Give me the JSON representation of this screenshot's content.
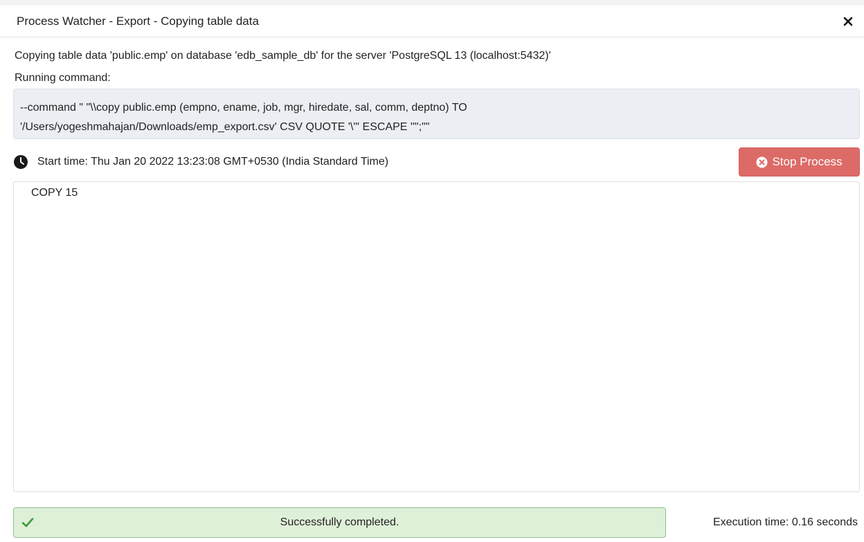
{
  "dialog": {
    "title": "Process Watcher - Export - Copying table data",
    "close_icon": "close-icon"
  },
  "description": "Copying table data 'public.emp' on database 'edb_sample_db' for the server 'PostgreSQL 13 (localhost:5432)'",
  "running_label": "Running command:",
  "command": {
    "line1": "--command \" \"\\\\copy public.emp (empno, ename, job, mgr, hiredate, sal, comm, deptno) TO",
    "line2": "'/Users/yogeshmahajan/Downloads/emp_export.csv' CSV QUOTE '\\\"' ESCAPE '\"';\"\""
  },
  "start_time": "Start time: Thu Jan 20 2022 13:23:08 GMT+0530 (India Standard Time)",
  "stop_button": {
    "label": "Stop Process",
    "icon": "times-circle-icon"
  },
  "output": {
    "lines": [
      "COPY 15"
    ]
  },
  "status": {
    "text": "Successfully completed.",
    "icon": "check-icon"
  },
  "execution_time": "Execution time: 0.16 seconds",
  "colors": {
    "stop_button": "#dc6b67",
    "success_bg": "#dff0d8",
    "success_border": "#8dc18d",
    "check": "#3c9a3c",
    "command_bg": "#ebeef3"
  }
}
